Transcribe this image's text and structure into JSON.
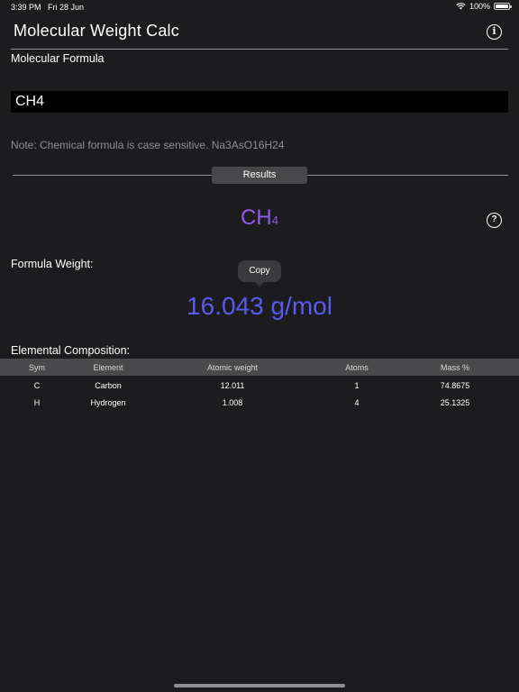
{
  "status_bar": {
    "time": "3:39 PM",
    "date": "Fri 28 Jun",
    "battery": "100%"
  },
  "nav": {
    "title": "Molecular Weight Calc"
  },
  "input": {
    "label": "Molecular Formula",
    "value": "CH4",
    "note": "Note: Chemical formula is case sensitive. Na3AsO16H24"
  },
  "results": {
    "badge": "Results",
    "formula_main": "CH",
    "formula_sub": "4",
    "weight_label": "Formula Weight:",
    "copy_label": "Copy",
    "weight_value": "16.043 g/mol",
    "composition_label": "Elemental Composition:"
  },
  "table": {
    "headers": {
      "sym": "Sym",
      "element": "Element",
      "atomic_weight": "Atomic weight",
      "atoms": "Atoms",
      "mass": "Mass %"
    },
    "rows": [
      {
        "sym": "C",
        "element": "Carbon",
        "atomic_weight": "12.011",
        "atoms": "1",
        "mass": "74.8675"
      },
      {
        "sym": "H",
        "element": "Hydrogen",
        "atomic_weight": "1.008",
        "atoms": "4",
        "mass": "25.1325"
      }
    ]
  },
  "colors": {
    "background": "#1c1c1e",
    "formula": "#8e5bf0",
    "weight": "#5a5af0",
    "header_row": "#4a4a4c"
  },
  "icons": {
    "info": "info-circle-icon",
    "help": "question-circle-icon",
    "wifi": "wifi-icon",
    "battery": "battery-icon"
  }
}
